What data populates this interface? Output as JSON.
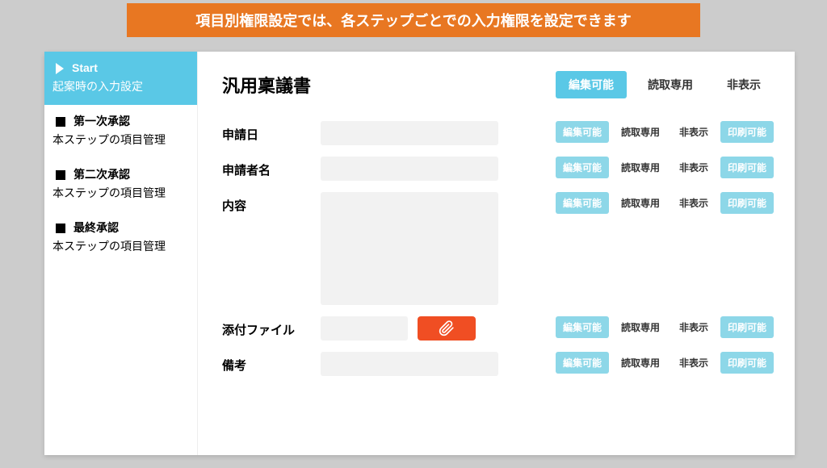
{
  "banner": "項目別権限設定では、各ステップごとでの入力権限を設定できます",
  "sidebar": {
    "items": [
      {
        "title": "Start",
        "subtitle": "起案時の入力設定",
        "active": true
      },
      {
        "title": "第一次承認",
        "subtitle": "本ステップの項目管理",
        "active": false
      },
      {
        "title": "第二次承認",
        "subtitle": "本ステップの項目管理",
        "active": false
      },
      {
        "title": "最終承認",
        "subtitle": "本ステップの項目管理",
        "active": false
      }
    ]
  },
  "main": {
    "title": "汎用稟議書",
    "top_buttons": {
      "edit": "編集可能",
      "readonly": "読取専用",
      "hidden": "非表示"
    }
  },
  "opts": {
    "edit": "編集可能",
    "readonly": "読取専用",
    "hidden": "非表示",
    "print": "印刷可能"
  },
  "fields": [
    {
      "label": "申請日"
    },
    {
      "label": "申請者名"
    },
    {
      "label": "内容"
    },
    {
      "label": "添付ファイル"
    },
    {
      "label": "備考"
    }
  ]
}
